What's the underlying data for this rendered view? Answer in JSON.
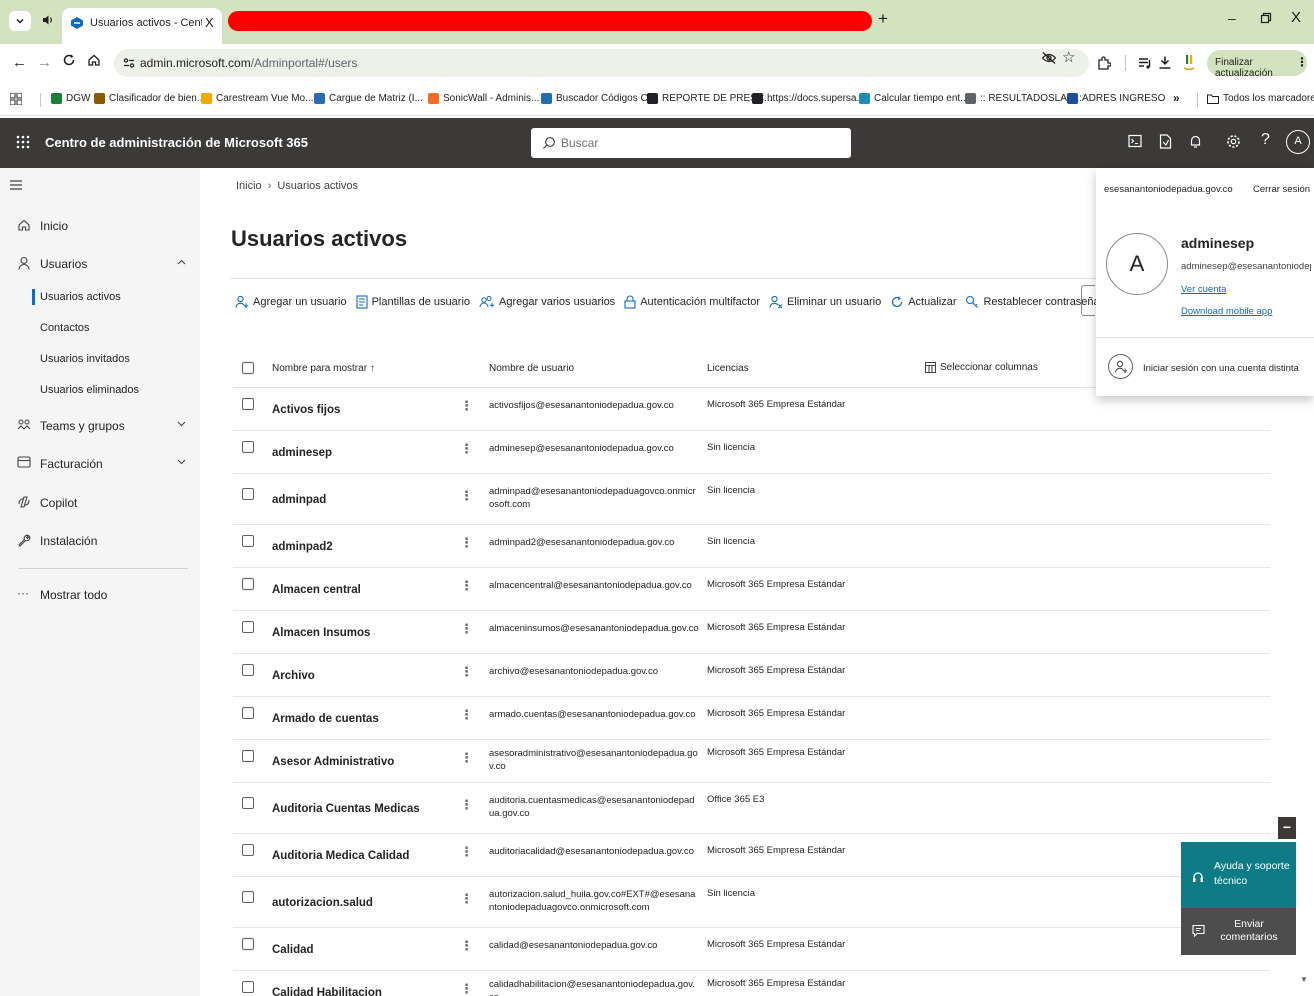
{
  "browser": {
    "active_tab_title": "Usuarios activos - Centro de ad",
    "tab_close": "X",
    "new_tab": "+",
    "window_controls": {
      "minimize": "–",
      "close": "X"
    },
    "url_host": "admin.microsoft.com",
    "url_path": "/Adminportal#/users",
    "update_button": "Finalizar actualización",
    "redaction_color": "#ff0000",
    "bookmarks": [
      {
        "label": "DGW",
        "icon": "mail-icon",
        "color": "#1a7f37"
      },
      {
        "label": "Clasificador de bien...",
        "icon": "bank-icon",
        "color": "#8a5a00"
      },
      {
        "label": "Carestream Vue Mo...",
        "icon": "carestream-icon",
        "color": "#f2a900"
      },
      {
        "label": "Cargue de Matriz (I...",
        "icon": "sheet-icon",
        "color": "#2b6cb0"
      },
      {
        "label": "SonicWall - Adminis...",
        "icon": "sonicwall-icon",
        "color": "#f26b21"
      },
      {
        "label": "Buscador Códigos C...",
        "icon": "search-doc-icon",
        "color": "#1f6fb2"
      },
      {
        "label": "REPORTE DE PRESC...",
        "icon": "globe-icon",
        "color": "#202124"
      },
      {
        "label": "https://docs.supersa...",
        "icon": "globe-icon",
        "color": "#202124"
      },
      {
        "label": "Calcular tiempo ent...",
        "icon": "calc-icon",
        "color": "#1a8fb4"
      },
      {
        "label": ":: RESULTADOSLAB ::",
        "icon": "lab-icon",
        "color": "#5f6368"
      },
      {
        "label": "ADRES INGRESO",
        "icon": "adres-icon",
        "color": "#1f4e9c"
      }
    ],
    "bookmarks_more": "»",
    "all_bookmarks": "Todos los marcadores"
  },
  "header": {
    "app_title": "Centro de administración de Microsoft 365",
    "search_placeholder": "Buscar",
    "avatar_initial": "A",
    "bg_color": "#3b3a39"
  },
  "nav": {
    "items": [
      {
        "label": "Inicio",
        "icon": "home-icon"
      },
      {
        "label": "Usuarios",
        "icon": "user-icon",
        "expanded": true
      },
      {
        "label": "Teams y grupos",
        "icon": "teams-icon"
      },
      {
        "label": "Facturación",
        "icon": "billing-icon"
      },
      {
        "label": "Copilot",
        "icon": "copilot-icon"
      },
      {
        "label": "Instalación",
        "icon": "setup-icon"
      },
      {
        "label": "Mostrar todo",
        "icon": "more-icon"
      }
    ],
    "sub_items": [
      "Usuarios activos",
      "Contactos",
      "Usuarios invitados",
      "Usuarios eliminados"
    ]
  },
  "main": {
    "breadcrumb": [
      "Inicio",
      "Usuarios activos"
    ],
    "title": "Usuarios activos",
    "commands": [
      "Agregar un usuario",
      "Plantillas de usuario",
      "Agregar varios usuarios",
      "Autenticación multifactor",
      "Eliminar un usuario",
      "Actualizar",
      "Restablecer contraseña"
    ],
    "table": {
      "headers": {
        "display_name": "Nombre para mostrar",
        "sort_indicator": "↑",
        "username": "Nombre de usuario",
        "licenses": "Licencias",
        "choose_columns": "Seleccionar columnas"
      },
      "rows": [
        {
          "name": "Activos fijos",
          "user": "activosfijos@esesanantoniodepadua.gov.co",
          "license": "Microsoft 365 Empresa Estándar"
        },
        {
          "name": "adminesep",
          "user": "adminesep@esesanantoniodepadua.gov.co",
          "license": "Sin licencia"
        },
        {
          "name": "adminpad",
          "user": "adminpad@esesanantoniodepaduagovco.onmicrosoft.com",
          "license": "Sin licencia"
        },
        {
          "name": "adminpad2",
          "user": "adminpad2@esesanantoniodepadua.gov.co",
          "license": "Sin licencia"
        },
        {
          "name": "Almacen central",
          "user": "almacencentral@esesanantoniodepadua.gov.co",
          "license": "Microsoft 365 Empresa Estándar"
        },
        {
          "name": "Almacen Insumos",
          "user": "almaceninsumos@esesanantoniodepadua.gov.co",
          "license": "Microsoft 365 Empresa Estándar"
        },
        {
          "name": "Archivo",
          "user": "archivo@esesanantoniodepadua.gov.co",
          "license": "Microsoft 365 Empresa Estándar"
        },
        {
          "name": "Armado de cuentas",
          "user": "armado.cuentas@esesanantoniodepadua.gov.co",
          "license": "Microsoft 365 Empresa Estándar"
        },
        {
          "name": "Asesor Administrativo",
          "user": "asesoradministrativo@esesanantoniodepadua.gov.co",
          "license": "Microsoft 365 Empresa Estándar"
        },
        {
          "name": "Auditoria Cuentas Medicas",
          "user": "auditoria.cuentasmedicas@esesanantoniodepadua.gov.co",
          "license": "Office 365 E3"
        },
        {
          "name": "Auditoria Medica Calidad",
          "user": "auditoriacalidad@esesanantoniodepadua.gov.co",
          "license": "Microsoft 365 Empresa Estándar"
        },
        {
          "name": "autorizacion.salud",
          "user": "autorizacion.salud_huila.gov.co#EXT#@esesanantoniodepaduagovco.onmicrosoft.com",
          "license": "Sin licencia"
        },
        {
          "name": "Calidad",
          "user": "calidad@esesanantoniodepadua.gov.co",
          "license": "Microsoft 365 Empresa Estándar"
        },
        {
          "name": "Calidad Habilitacion",
          "user": "calidadhabilitacion@esesanantoniodepadua.gov.co",
          "license": "Microsoft 365 Empresa Estándar"
        }
      ]
    }
  },
  "account": {
    "tenant": "esesanantoniodepadua.gov.co",
    "sign_out": "Cerrar sesión",
    "avatar_initial": "A",
    "name": "adminesep",
    "email": "adminesep@esesanantoniodepadua.gov.co",
    "view_account": "Ver cuenta",
    "download_app": "Download mobile app",
    "other_account": "Iniciar sesión con una cuenta distinta"
  },
  "help": {
    "collapse": "−",
    "support_label": "Ayuda y soporte técnico",
    "feedback_label": "Enviar comentarios",
    "support_color": "#0e7c86"
  }
}
